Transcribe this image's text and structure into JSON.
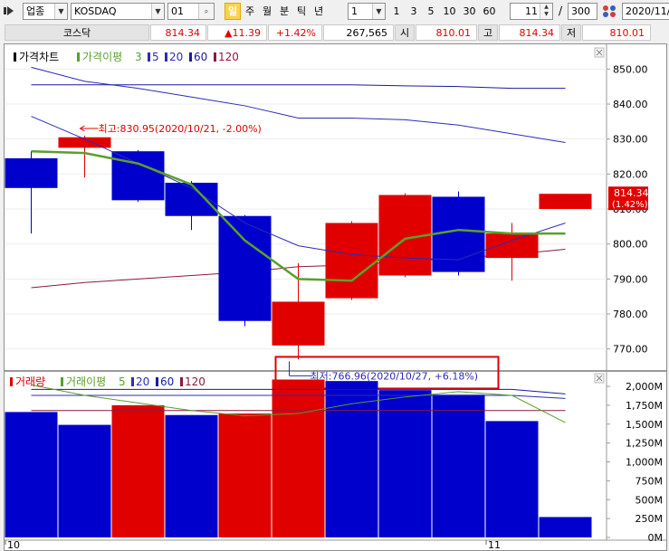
{
  "toolbar": {
    "market_type": "업종",
    "index_name": "KOSDAQ",
    "period_value": "01",
    "periods": [
      {
        "label": "일",
        "selected": true
      },
      {
        "label": "주",
        "selected": false
      },
      {
        "label": "월",
        "selected": false
      },
      {
        "label": "분",
        "selected": false
      },
      {
        "label": "틱",
        "selected": false
      },
      {
        "label": "년",
        "selected": false
      }
    ],
    "interval_value": "1",
    "intervals": [
      "1",
      "3",
      "5",
      "10",
      "30",
      "60"
    ],
    "view_count": "11",
    "total_count": "300",
    "separator": "/",
    "date_value": "2020/11/"
  },
  "quote": {
    "name": "코스닥",
    "price": "814.34",
    "change": "11.39",
    "change_arrow": "▲",
    "change_pct": "+1.42%",
    "volume": "267,565",
    "open_label": "시",
    "open": "810.01",
    "high_label": "고",
    "high": "814.34",
    "low_label": "저",
    "low": "810.01"
  },
  "colors": {
    "up": "#e00000",
    "down": "#0000cc",
    "ma3": "#5aa02c",
    "ma5": "#2c2cb4",
    "ma20": "#2c2cb4",
    "ma60": "#1a1aa0",
    "ma120": "#8c1a3c",
    "highlight_box": "#e00000"
  },
  "chart_data": [
    {
      "type": "candlestick",
      "legend": {
        "title": "가격차트",
        "ma_title": "가격이평",
        "periods": [
          "3",
          "5",
          "20",
          "60",
          "120"
        ]
      },
      "yticks": [
        "850.00",
        "840.00",
        "830.00",
        "820.00",
        "810.00",
        "800.00",
        "790.00",
        "780.00",
        "770.00"
      ],
      "ylim": [
        765,
        855
      ],
      "xticks": [
        {
          "label": "10",
          "index": 0
        },
        {
          "label": "11",
          "index": 9
        }
      ],
      "candles": [
        {
          "open": 824.5,
          "high": 826.5,
          "low": 803.0,
          "close": 816.0
        },
        {
          "open": 827.5,
          "high": 830.95,
          "low": 819.0,
          "close": 830.5
        },
        {
          "open": 826.5,
          "high": 826.8,
          "low": 812.0,
          "close": 812.5
        },
        {
          "open": 817.5,
          "high": 818.0,
          "low": 804.0,
          "close": 808.0
        },
        {
          "open": 808.0,
          "high": 808.3,
          "low": 776.5,
          "close": 778.0
        },
        {
          "open": 771.0,
          "high": 794.5,
          "low": 766.96,
          "close": 783.5
        },
        {
          "open": 784.5,
          "high": 806.5,
          "low": 784.0,
          "close": 806.0
        },
        {
          "open": 791.0,
          "high": 814.5,
          "low": 790.5,
          "close": 814.0
        },
        {
          "open": 813.5,
          "high": 815.0,
          "low": 791.0,
          "close": 792.0
        },
        {
          "open": 796.0,
          "high": 806.0,
          "low": 789.5,
          "close": 803.0
        },
        {
          "open": 810.01,
          "high": 814.34,
          "low": 810.01,
          "close": 814.34
        }
      ],
      "ma3": [
        826.5,
        826.0,
        823.0,
        817.0,
        801.0,
        790.0,
        789.5,
        801.5,
        804.0,
        803.0,
        803.0
      ],
      "ma5": [
        836.5,
        830.0,
        823.0,
        816.0,
        806.0,
        799.5,
        797.0,
        796.0,
        795.5,
        801.0,
        806.0
      ],
      "ma20": [
        850.5,
        846.5,
        844.5,
        842.0,
        839.5,
        836.0,
        836.0,
        835.5,
        834.0,
        831.5,
        829.0
      ],
      "ma60": [
        845.5,
        845.5,
        845.5,
        845.5,
        845.5,
        845.5,
        845.5,
        845.2,
        845.0,
        844.5,
        844.5
      ],
      "ma120": [
        787.5,
        789.0,
        790.0,
        791.0,
        792.0,
        793.5,
        794.0,
        795.0,
        796.0,
        797.0,
        798.5
      ],
      "current_price_label": "814.34",
      "current_pct_label": "(1.42%)",
      "annotations": {
        "high": {
          "text": "최고:830.95(2020/10/21, -2.00%)",
          "index": 1,
          "value": 830.95
        },
        "low": {
          "text": "최저:766.96(2020/10/27, +6.18%)",
          "index": 5,
          "value": 766.96
        }
      }
    },
    {
      "type": "bar",
      "legend": {
        "title": "거래량",
        "ma_title": "거래이평",
        "periods": [
          "5",
          "20",
          "60",
          "120"
        ]
      },
      "yticks": [
        "2,000M",
        "1,750M",
        "1,500M",
        "1,250M",
        "1,000M",
        "750M",
        "500M",
        "250M",
        "0M"
      ],
      "ylim": [
        0,
        2000
      ],
      "values": [
        1660,
        1490,
        1750,
        1620,
        1640,
        2090,
        2070,
        1950,
        1890,
        1540,
        270
      ],
      "up_down": [
        "down",
        "down",
        "up",
        "down",
        "up",
        "up",
        "down",
        "down",
        "down",
        "down",
        "down"
      ],
      "ma5": [
        2020,
        1880,
        1780,
        1680,
        1610,
        1640,
        1770,
        1860,
        1930,
        1880,
        1520
      ],
      "ma20": [
        1880,
        1880,
        1880,
        1880,
        1880,
        1880,
        1880,
        1880,
        1880,
        1880,
        1840
      ],
      "ma60": [
        1960,
        1960,
        1960,
        1960,
        1960,
        1960,
        1960,
        1960,
        1960,
        1960,
        1900
      ],
      "ma120": [
        1680,
        1680,
        1680,
        1680,
        1680,
        1680,
        1680,
        1680,
        1680,
        1680,
        1680
      ]
    }
  ]
}
